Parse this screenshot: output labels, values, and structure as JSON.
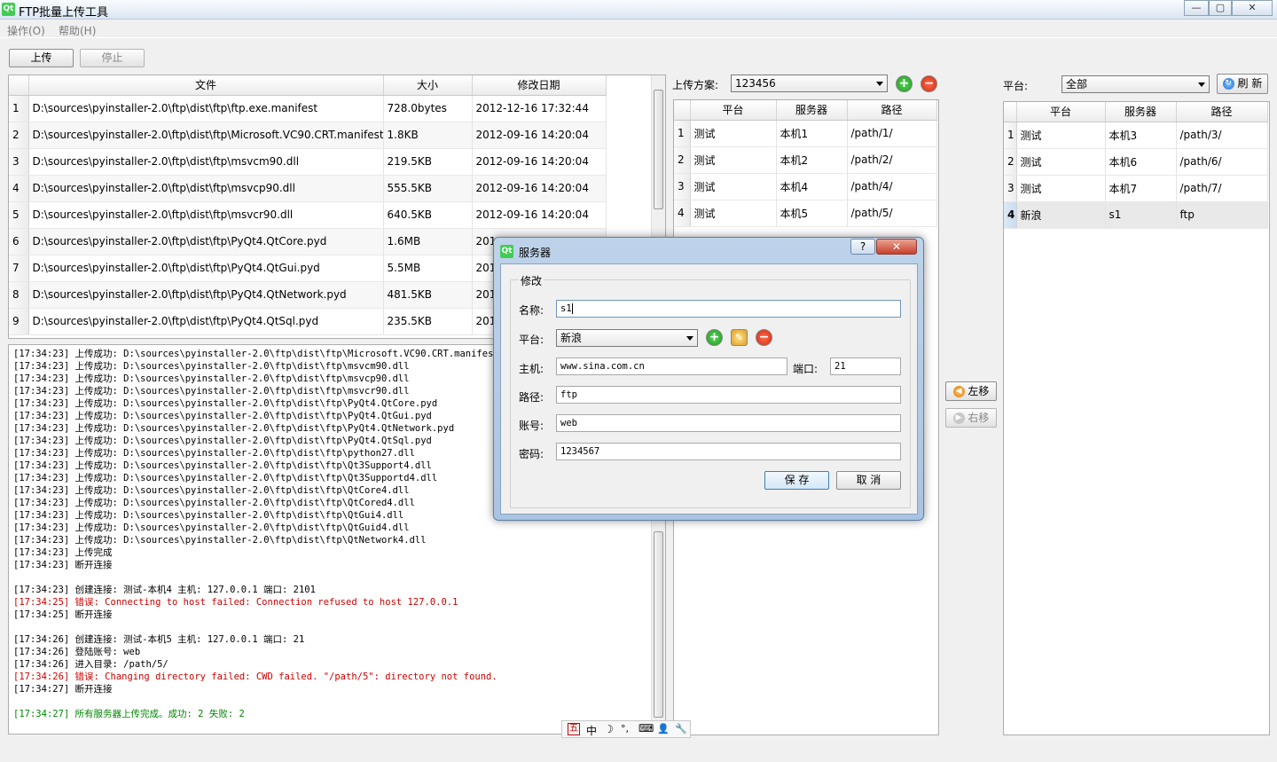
{
  "window": {
    "title": "FTP批量上传工具",
    "minimize": "—",
    "maximize": "▢",
    "close": "✕"
  },
  "menu": {
    "items": [
      "操作(O)",
      "帮助(H)"
    ]
  },
  "toolbar": {
    "upload_label": "上传",
    "stop_label": "停止"
  },
  "files": {
    "columns": [
      "文件",
      "大小",
      "修改日期"
    ],
    "rows": [
      {
        "n": "1",
        "file": "D:\\sources\\pyinstaller-2.0\\ftp\\dist\\ftp\\ftp.exe.manifest",
        "size": "728.0bytes",
        "date": "2012-12-16 17:32:44"
      },
      {
        "n": "2",
        "file": "D:\\sources\\pyinstaller-2.0\\ftp\\dist\\ftp\\Microsoft.VC90.CRT.manifest",
        "size": "1.8KB",
        "date": "2012-09-16 14:20:04"
      },
      {
        "n": "3",
        "file": "D:\\sources\\pyinstaller-2.0\\ftp\\dist\\ftp\\msvcm90.dll",
        "size": "219.5KB",
        "date": "2012-09-16 14:20:04"
      },
      {
        "n": "4",
        "file": "D:\\sources\\pyinstaller-2.0\\ftp\\dist\\ftp\\msvcp90.dll",
        "size": "555.5KB",
        "date": "2012-09-16 14:20:04"
      },
      {
        "n": "5",
        "file": "D:\\sources\\pyinstaller-2.0\\ftp\\dist\\ftp\\msvcr90.dll",
        "size": "640.5KB",
        "date": "2012-09-16 14:20:04"
      },
      {
        "n": "6",
        "file": "D:\\sources\\pyinstaller-2.0\\ftp\\dist\\ftp\\PyQt4.QtCore.pyd",
        "size": "1.6MB",
        "date": "201"
      },
      {
        "n": "7",
        "file": "D:\\sources\\pyinstaller-2.0\\ftp\\dist\\ftp\\PyQt4.QtGui.pyd",
        "size": "5.5MB",
        "date": "201"
      },
      {
        "n": "8",
        "file": "D:\\sources\\pyinstaller-2.0\\ftp\\dist\\ftp\\PyQt4.QtNetwork.pyd",
        "size": "481.5KB",
        "date": "201"
      },
      {
        "n": "9",
        "file": "D:\\sources\\pyinstaller-2.0\\ftp\\dist\\ftp\\PyQt4.QtSql.pyd",
        "size": "235.5KB",
        "date": "201"
      }
    ]
  },
  "log": {
    "lines": [
      {
        "text": "[17:34:23] 上传成功: D:\\sources\\pyinstaller-2.0\\ftp\\dist\\ftp\\Microsoft.VC90.CRT.manifest",
        "type": "normal"
      },
      {
        "text": "[17:34:23] 上传成功: D:\\sources\\pyinstaller-2.0\\ftp\\dist\\ftp\\msvcm90.dll",
        "type": "normal"
      },
      {
        "text": "[17:34:23] 上传成功: D:\\sources\\pyinstaller-2.0\\ftp\\dist\\ftp\\msvcp90.dll",
        "type": "normal"
      },
      {
        "text": "[17:34:23] 上传成功: D:\\sources\\pyinstaller-2.0\\ftp\\dist\\ftp\\msvcr90.dll",
        "type": "normal"
      },
      {
        "text": "[17:34:23] 上传成功: D:\\sources\\pyinstaller-2.0\\ftp\\dist\\ftp\\PyQt4.QtCore.pyd",
        "type": "normal"
      },
      {
        "text": "[17:34:23] 上传成功: D:\\sources\\pyinstaller-2.0\\ftp\\dist\\ftp\\PyQt4.QtGui.pyd",
        "type": "normal"
      },
      {
        "text": "[17:34:23] 上传成功: D:\\sources\\pyinstaller-2.0\\ftp\\dist\\ftp\\PyQt4.QtNetwork.pyd",
        "type": "normal"
      },
      {
        "text": "[17:34:23] 上传成功: D:\\sources\\pyinstaller-2.0\\ftp\\dist\\ftp\\PyQt4.QtSql.pyd",
        "type": "normal"
      },
      {
        "text": "[17:34:23] 上传成功: D:\\sources\\pyinstaller-2.0\\ftp\\dist\\ftp\\python27.dll",
        "type": "normal"
      },
      {
        "text": "[17:34:23] 上传成功: D:\\sources\\pyinstaller-2.0\\ftp\\dist\\ftp\\Qt3Support4.dll",
        "type": "normal"
      },
      {
        "text": "[17:34:23] 上传成功: D:\\sources\\pyinstaller-2.0\\ftp\\dist\\ftp\\Qt3Supportd4.dll",
        "type": "normal"
      },
      {
        "text": "[17:34:23] 上传成功: D:\\sources\\pyinstaller-2.0\\ftp\\dist\\ftp\\QtCore4.dll",
        "type": "normal"
      },
      {
        "text": "[17:34:23] 上传成功: D:\\sources\\pyinstaller-2.0\\ftp\\dist\\ftp\\QtCored4.dll",
        "type": "normal"
      },
      {
        "text": "[17:34:23] 上传成功: D:\\sources\\pyinstaller-2.0\\ftp\\dist\\ftp\\QtGui4.dll",
        "type": "normal"
      },
      {
        "text": "[17:34:23] 上传成功: D:\\sources\\pyinstaller-2.0\\ftp\\dist\\ftp\\QtGuid4.dll",
        "type": "normal"
      },
      {
        "text": "[17:34:23] 上传成功: D:\\sources\\pyinstaller-2.0\\ftp\\dist\\ftp\\QtNetwork4.dll",
        "type": "normal"
      },
      {
        "text": "[17:34:23] 上传完成",
        "type": "normal"
      },
      {
        "text": "[17:34:23] 断开连接",
        "type": "normal"
      },
      {
        "text": "",
        "type": "normal"
      },
      {
        "text": "[17:34:23] 创建连接: 测试-本机4 主机: 127.0.0.1 端口: 2101",
        "type": "normal"
      },
      {
        "text": "[17:34:25] 错误: Connecting to host failed: Connection refused to host 127.0.0.1",
        "type": "err"
      },
      {
        "text": "[17:34:25] 断开连接",
        "type": "normal"
      },
      {
        "text": "",
        "type": "normal"
      },
      {
        "text": "[17:34:26] 创建连接: 测试-本机5 主机: 127.0.0.1 端口: 21",
        "type": "normal"
      },
      {
        "text": "[17:34:26] 登陆账号: web",
        "type": "normal"
      },
      {
        "text": "[17:34:26] 进入目录: /path/5/",
        "type": "normal"
      },
      {
        "text": "[17:34:26] 错误: Changing directory failed: CWD failed. \"/path/5\": directory not found.",
        "type": "err"
      },
      {
        "text": "[17:34:27] 断开连接",
        "type": "normal"
      },
      {
        "text": "",
        "type": "normal"
      },
      {
        "text": "[17:34:27] 所有服务器上传完成。成功: 2 失败: 2",
        "type": "ok"
      }
    ]
  },
  "scheme": {
    "label": "上传方案:",
    "selected": "123456",
    "columns": [
      "平台",
      "服务器",
      "路径"
    ],
    "rows": [
      {
        "n": "1",
        "platform": "测试",
        "server": "本机1",
        "path": "/path/1/"
      },
      {
        "n": "2",
        "platform": "测试",
        "server": "本机2",
        "path": "/path/2/"
      },
      {
        "n": "3",
        "platform": "测试",
        "server": "本机4",
        "path": "/path/4/"
      },
      {
        "n": "4",
        "platform": "测试",
        "server": "本机5",
        "path": "/path/5/"
      }
    ]
  },
  "move": {
    "left_label": "左移",
    "right_label": "右移"
  },
  "platform": {
    "label": "平台:",
    "selected": "全部",
    "refresh_label": "刷 新",
    "columns": [
      "平台",
      "服务器",
      "路径"
    ],
    "rows": [
      {
        "n": "1",
        "platform": "测试",
        "server": "本机3",
        "path": "/path/3/"
      },
      {
        "n": "2",
        "platform": "测试",
        "server": "本机6",
        "path": "/path/6/"
      },
      {
        "n": "3",
        "platform": "测试",
        "server": "本机7",
        "path": "/path/7/"
      },
      {
        "n": "4",
        "platform": "新浪",
        "server": "s1",
        "path": "ftp"
      }
    ]
  },
  "dialog": {
    "title": "服务器",
    "help": "?",
    "close": "✕",
    "group_title": "修改",
    "name_label": "名称:",
    "name_value": "s1",
    "platform_label": "平台:",
    "platform_value": "新浪",
    "host_label": "主机:",
    "host_value": "www.sina.com.cn",
    "port_label": "端口:",
    "port_value": "21",
    "path_label": "路径:",
    "path_value": "ftp",
    "account_label": "账号:",
    "account_value": "web",
    "password_label": "密码:",
    "password_value": "1234567",
    "save_label": "保 存",
    "cancel_label": "取 消"
  },
  "ime": {
    "glyphs": [
      "五",
      "中",
      "☽",
      "°,",
      "⌨",
      "👤",
      "🔧"
    ]
  }
}
